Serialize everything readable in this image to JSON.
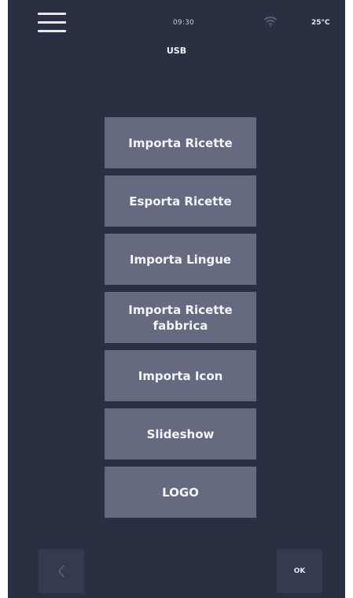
{
  "status_bar": {
    "time": "09:30",
    "temperature": "25°C"
  },
  "title": "USB",
  "menu": {
    "items": [
      {
        "label": "Importa Ricette"
      },
      {
        "label": "Esporta Ricette"
      },
      {
        "label": "Importa Lingue"
      },
      {
        "label": "Importa Ricette fabbrica"
      },
      {
        "label": "Importa Icon"
      },
      {
        "label": "Slideshow"
      },
      {
        "label": "LOGO"
      }
    ]
  },
  "footer": {
    "ok_label": "OK"
  },
  "icons": {
    "menu": "hamburger-menu-icon",
    "wifi": "wifi-icon",
    "back": "chevron-left-icon"
  },
  "colors": {
    "background": "#2a2f42",
    "button": "#666a80",
    "nav_button": "#343a4f",
    "text": "#f4f5f9"
  }
}
